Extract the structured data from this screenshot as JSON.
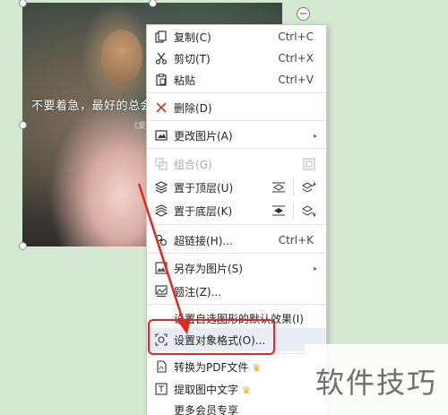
{
  "slide": {
    "quote": "不要着急，最好的总会",
    "subtext": "《爱情"
  },
  "context_menu": {
    "items": [
      {
        "label": "复制(C)",
        "shortcut": "Ctrl+C",
        "icon": "copy-icon"
      },
      {
        "label": "剪切(T)",
        "shortcut": "Ctrl+X",
        "icon": "scissors-icon"
      },
      {
        "label": "粘贴",
        "shortcut": "Ctrl+V",
        "icon": "paste-icon"
      },
      {
        "label": "删除(D)",
        "icon": "delete-x-icon"
      },
      {
        "label": "更改图片(A)",
        "icon": "change-picture-icon",
        "submenu": true
      },
      {
        "label": "组合(G)",
        "icon": "group-icon",
        "disabled": true
      },
      {
        "label": "置于顶层(U)",
        "icon": "bring-to-front-icon"
      },
      {
        "label": "置于底层(K)",
        "icon": "send-to-back-icon"
      },
      {
        "label": "超链接(H)...",
        "shortcut": "Ctrl+K",
        "icon": "hyperlink-icon"
      },
      {
        "label": "另存为图片(S)",
        "icon": "save-as-picture-icon",
        "submenu": true
      },
      {
        "label": "题注(Z)...",
        "icon": "caption-icon"
      },
      {
        "label": "设置自选图形的默认效果(I)"
      },
      {
        "label": "设置对象格式(O)...",
        "icon": "format-object-icon"
      },
      {
        "label": "转换为PDF文件",
        "icon": "pdf-icon",
        "premium": true
      },
      {
        "label": "提取图中文字",
        "icon": "extract-text-icon",
        "premium": true
      },
      {
        "label": "更多会员专享"
      }
    ]
  },
  "watermark": "软件技巧",
  "colors": {
    "highlight_box": "#e3261e",
    "premium_crown": "#e8a520",
    "background": "#d5e8d1"
  }
}
